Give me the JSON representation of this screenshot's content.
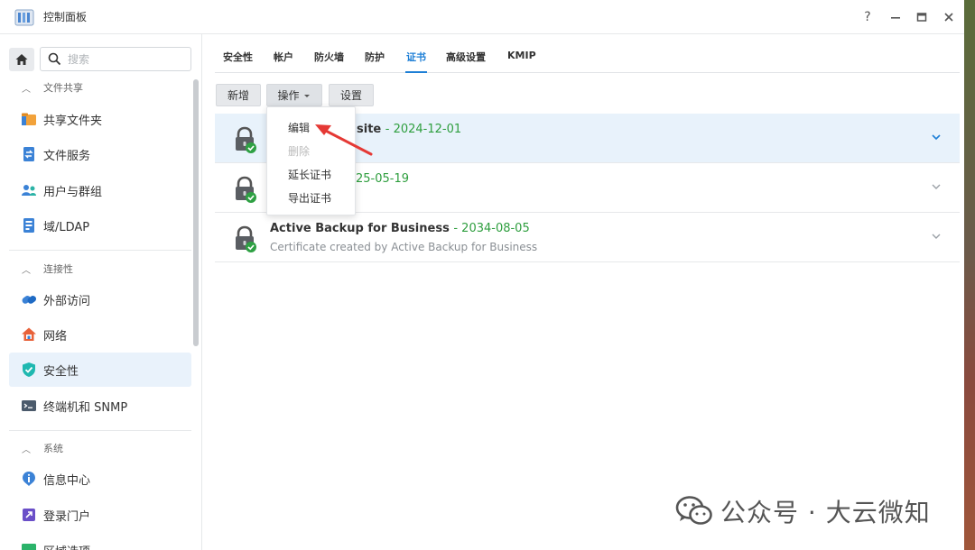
{
  "window": {
    "title": "控制面板",
    "help_label": "?"
  },
  "sidebar": {
    "search_placeholder": "搜索",
    "sections": [
      {
        "label": "文件共享"
      },
      {
        "label": "连接性"
      },
      {
        "label": "系统"
      }
    ],
    "items": [
      {
        "label": "共享文件夹",
        "icon": "folder-share-icon"
      },
      {
        "label": "文件服务",
        "icon": "file-services-icon"
      },
      {
        "label": "用户与群组",
        "icon": "users-icon"
      },
      {
        "label": "域/LDAP",
        "icon": "domain-ldap-icon"
      },
      {
        "label": "外部访问",
        "icon": "external-access-icon"
      },
      {
        "label": "网络",
        "icon": "network-icon"
      },
      {
        "label": "安全性",
        "icon": "security-shield-icon",
        "active": true
      },
      {
        "label": "终端机和 SNMP",
        "icon": "terminal-icon"
      },
      {
        "label": "信息中心",
        "icon": "info-center-icon"
      },
      {
        "label": "登录门户",
        "icon": "login-portal-icon"
      },
      {
        "label": "区域选项",
        "icon": "regional-options-icon"
      }
    ]
  },
  "tabs": [
    {
      "label": "安全性"
    },
    {
      "label": "帐户"
    },
    {
      "label": "防火墙"
    },
    {
      "label": "防护"
    },
    {
      "label": "证书",
      "active": true
    },
    {
      "label": "高级设置"
    },
    {
      "label": "KMIP"
    }
  ],
  "toolbar": {
    "add_label": "新增",
    "action_label": "操作",
    "settings_label": "设置"
  },
  "action_menu": {
    "items": [
      {
        "label": "编辑",
        "enabled": true
      },
      {
        "label": "删除",
        "enabled": false
      },
      {
        "label": "延长证书",
        "enabled": true
      },
      {
        "label": "导出证书",
        "enabled": true
      }
    ]
  },
  "certificates": [
    {
      "name": "site",
      "date": "- 2024-12-01",
      "subtitle": "",
      "selected": true
    },
    {
      "name": "",
      "date": "25-05-19",
      "subtitle": "",
      "selected": false
    },
    {
      "name": "Active Backup for Business",
      "date": "- 2034-08-05",
      "subtitle": "Certificate created by Active Backup for Business",
      "selected": false
    }
  ],
  "watermark": {
    "text": "公众号 · 大云微知"
  },
  "colors": {
    "accent": "#1e7fd6",
    "date_green": "#2e9e3e",
    "selected_row": "#e8f2fb",
    "annotation_arrow": "#e53935"
  }
}
